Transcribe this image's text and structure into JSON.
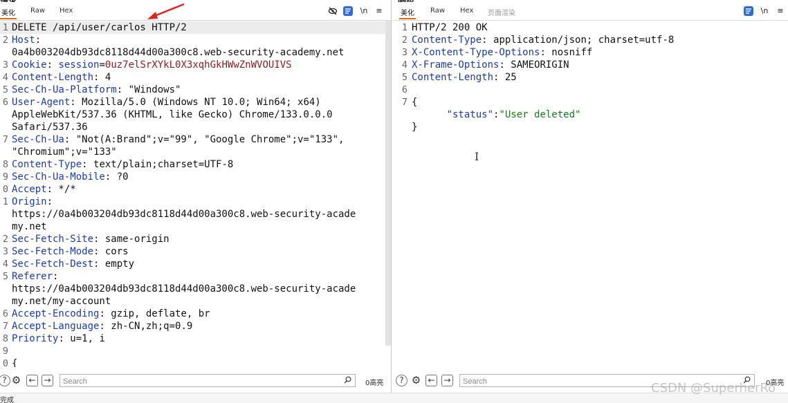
{
  "request": {
    "caption": "请求",
    "tabs": [
      "美化",
      "Raw",
      "Hex"
    ],
    "lines": [
      {
        "n": "1",
        "parts": [
          {
            "t": "DELETE /api/user/carlos HTTP/2",
            "c": ""
          }
        ]
      },
      {
        "n": "2",
        "parts": [
          {
            "t": "Host",
            "c": "k"
          },
          {
            "t": ":",
            "c": ""
          }
        ]
      },
      {
        "n": "",
        "parts": [
          {
            "t": "0a4b003204db93dc8118d44d00a300c8.web-security-academy.net",
            "c": ""
          }
        ]
      },
      {
        "n": "3",
        "parts": [
          {
            "t": "Cookie",
            "c": "k"
          },
          {
            "t": ": ",
            "c": ""
          },
          {
            "t": "session",
            "c": "k"
          },
          {
            "t": "=",
            "c": ""
          },
          {
            "t": "0uz7elSrXYkL0X3xqhGkHWwZnWVOUIVS",
            "c": "cv"
          }
        ]
      },
      {
        "n": "4",
        "parts": [
          {
            "t": "Content-Length",
            "c": "k"
          },
          {
            "t": ": 4",
            "c": ""
          }
        ]
      },
      {
        "n": "5",
        "parts": [
          {
            "t": "Sec-Ch-Ua-Platform",
            "c": "k"
          },
          {
            "t": ": \"Windows\"",
            "c": ""
          }
        ]
      },
      {
        "n": "6",
        "parts": [
          {
            "t": "User-Agent",
            "c": "k"
          },
          {
            "t": ": Mozilla/5.0 (Windows NT 10.0; Win64; x64)",
            "c": ""
          }
        ]
      },
      {
        "n": "",
        "parts": [
          {
            "t": "AppleWebKit/537.36 (KHTML, like Gecko) Chrome/133.0.0.0",
            "c": ""
          }
        ]
      },
      {
        "n": "",
        "parts": [
          {
            "t": "Safari/537.36",
            "c": ""
          }
        ]
      },
      {
        "n": "7",
        "parts": [
          {
            "t": "Sec-Ch-Ua",
            "c": "k"
          },
          {
            "t": ": \"Not(A:Brand\";v=\"99\", \"Google Chrome\";v=\"133\",",
            "c": ""
          }
        ]
      },
      {
        "n": "",
        "parts": [
          {
            "t": "\"Chromium\";v=\"133\"",
            "c": ""
          }
        ]
      },
      {
        "n": "8",
        "parts": [
          {
            "t": "Content-Type",
            "c": "k"
          },
          {
            "t": ": text/plain;charset=UTF-8",
            "c": ""
          }
        ]
      },
      {
        "n": "9",
        "parts": [
          {
            "t": "Sec-Ch-Ua-Mobile",
            "c": "k"
          },
          {
            "t": ": ?0",
            "c": ""
          }
        ]
      },
      {
        "n": "0",
        "parts": [
          {
            "t": "Accept",
            "c": "k"
          },
          {
            "t": ": */*",
            "c": ""
          }
        ]
      },
      {
        "n": "1",
        "parts": [
          {
            "t": "Origin",
            "c": "k"
          },
          {
            "t": ":",
            "c": ""
          }
        ]
      },
      {
        "n": "",
        "parts": [
          {
            "t": "https://0a4b003204db93dc8118d44d00a300c8.web-security-acade",
            "c": ""
          }
        ]
      },
      {
        "n": "",
        "parts": [
          {
            "t": "my.net",
            "c": ""
          }
        ]
      },
      {
        "n": "2",
        "parts": [
          {
            "t": "Sec-Fetch-Site",
            "c": "k"
          },
          {
            "t": ": same-origin",
            "c": ""
          }
        ]
      },
      {
        "n": "3",
        "parts": [
          {
            "t": "Sec-Fetch-Mode",
            "c": "k"
          },
          {
            "t": ": cors",
            "c": ""
          }
        ]
      },
      {
        "n": "4",
        "parts": [
          {
            "t": "Sec-Fetch-Dest",
            "c": "k"
          },
          {
            "t": ": empty",
            "c": ""
          }
        ]
      },
      {
        "n": "5",
        "parts": [
          {
            "t": "Referer",
            "c": "k"
          },
          {
            "t": ":",
            "c": ""
          }
        ]
      },
      {
        "n": "",
        "parts": [
          {
            "t": "https://0a4b003204db93dc8118d44d00a300c8.web-security-acade",
            "c": ""
          }
        ]
      },
      {
        "n": "",
        "parts": [
          {
            "t": "my.net/my-account",
            "c": ""
          }
        ]
      },
      {
        "n": "6",
        "parts": [
          {
            "t": "Accept-Encoding",
            "c": "k"
          },
          {
            "t": ": gzip, deflate, br",
            "c": ""
          }
        ]
      },
      {
        "n": "7",
        "parts": [
          {
            "t": "Accept-Language",
            "c": "k"
          },
          {
            "t": ": zh-CN,zh;q=0.9",
            "c": ""
          }
        ]
      },
      {
        "n": "8",
        "parts": [
          {
            "t": "Priority",
            "c": "k"
          },
          {
            "t": ": u=1, i",
            "c": ""
          }
        ]
      },
      {
        "n": "9",
        "parts": [
          {
            "t": "",
            "c": ""
          }
        ]
      },
      {
        "n": "0",
        "parts": [
          {
            "t": "{",
            "c": ""
          }
        ]
      }
    ],
    "search_placeholder": "Search",
    "match_count": "0高亮"
  },
  "response": {
    "caption": "响应",
    "tabs": [
      "美化",
      "Raw",
      "Hex",
      "页面渲染"
    ],
    "lines": [
      {
        "n": "1",
        "parts": [
          {
            "t": "HTTP/2 200 OK",
            "c": ""
          }
        ]
      },
      {
        "n": "2",
        "parts": [
          {
            "t": "Content-Type",
            "c": "k"
          },
          {
            "t": ": application/json; charset=utf-8",
            "c": ""
          }
        ]
      },
      {
        "n": "3",
        "parts": [
          {
            "t": "X-Content-Type-Options",
            "c": "k"
          },
          {
            "t": ": nosniff",
            "c": ""
          }
        ]
      },
      {
        "n": "4",
        "parts": [
          {
            "t": "X-Frame-Options",
            "c": "k"
          },
          {
            "t": ": SAMEORIGIN",
            "c": ""
          }
        ]
      },
      {
        "n": "5",
        "parts": [
          {
            "t": "Content-Length",
            "c": "k"
          },
          {
            "t": ": 25",
            "c": ""
          }
        ]
      },
      {
        "n": "6",
        "parts": [
          {
            "t": "",
            "c": ""
          }
        ]
      },
      {
        "n": "7",
        "parts": [
          {
            "t": "{",
            "c": ""
          }
        ]
      },
      {
        "n": "",
        "parts": [
          {
            "t": "      ",
            "c": ""
          },
          {
            "t": "\"status\"",
            "c": "jk"
          },
          {
            "t": ":",
            "c": ""
          },
          {
            "t": "\"User deleted\"",
            "c": "js"
          }
        ]
      },
      {
        "n": "",
        "parts": [
          {
            "t": "}",
            "c": ""
          }
        ]
      }
    ],
    "search_placeholder": "Search",
    "match_count": "0高亮"
  },
  "status_bar": {
    "text": "完成"
  },
  "watermark": "CSDN @SuperherRo",
  "colors": {
    "accent_tab": "#e06a1b",
    "header_key": "#1b3bb0",
    "cookie_value": "#8b1c1c",
    "json_string": "#1a7a1a",
    "arrow": "#e0241b"
  },
  "icons": {
    "toolbar": [
      "eye-off-icon",
      "wrap-lines-icon",
      "newline-icon",
      "menu-icon"
    ],
    "bottombar": [
      "help-icon",
      "settings-icon",
      "back-arrow-icon",
      "forward-arrow-icon",
      "search-icon"
    ]
  }
}
